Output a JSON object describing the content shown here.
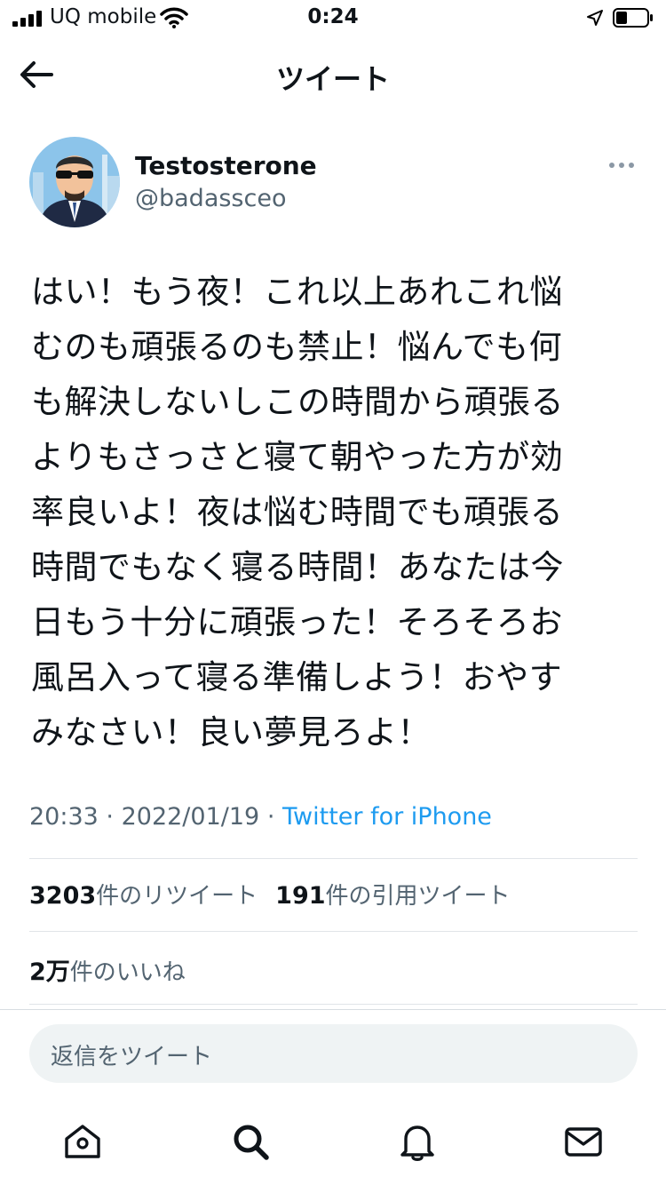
{
  "status_bar": {
    "carrier": "UQ mobile",
    "time": "0:24"
  },
  "header": {
    "title": "ツイート"
  },
  "tweet": {
    "author_name": "Testosterone",
    "author_handle": "@badassceo",
    "text": "はい！もう夜！これ以上あれこれ悩\nむのも頑張るのも禁止！悩んでも何\nも解決しないしこの時間から頑張る\nよりもさっさと寝て朝やった方が効\n率良いよ！夜は悩む時間でも頑張る\n時間でもなく寝る時間！あなたは今\n日もう十分に頑張った！そろそろお\n風呂入って寝る準備しよう！おやす\nみなさい！良い夢見ろよ！",
    "time": "20:33",
    "date": "2022/01/19",
    "separator": "·",
    "source": "Twitter for iPhone"
  },
  "stats": {
    "retweets_count": "3203",
    "retweets_label": "件のリツイート",
    "quotes_count": "191",
    "quotes_label": "件の引用ツイート",
    "likes_count": "2万",
    "likes_label": "件のいいね"
  },
  "reply": {
    "placeholder": "返信をツイート"
  },
  "tabs": [
    "home-icon",
    "search-icon",
    "notifications-icon",
    "messages-icon"
  ],
  "colors": {
    "link": "#1d9bf0",
    "secondary_text": "#536471",
    "primary_text": "#0f1419",
    "reply_bg": "#eff3f4"
  }
}
